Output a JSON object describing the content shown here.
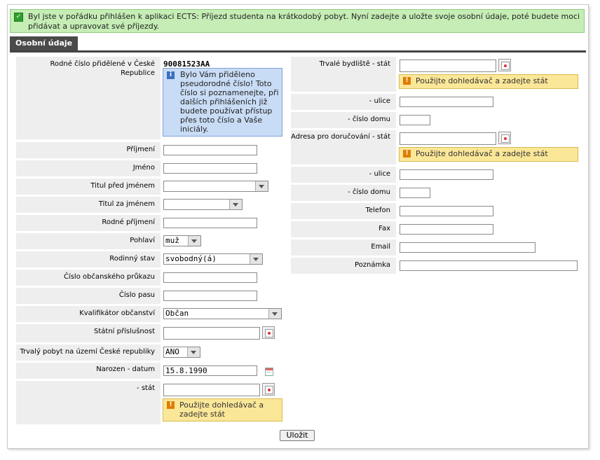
{
  "notice": {
    "text": "Byl jste v pořádku přihlášen k aplikaci ECTS: Příjezd studenta na krátkodobý pobyt. Nyní zadejte a uložte svoje osobní údaje, poté budete moci přidávat a upravovat své příjezdy."
  },
  "tab": {
    "label": "Osobní údaje"
  },
  "left": {
    "rodne_cislo_label": "Rodné číslo přidělené v České Republice",
    "rodne_cislo_value": "90081523AA",
    "info_text": "Bylo Vám přiděleno pseudorodné číslo! Toto číslo si poznamenejte, při dalších přihlášeních již budete používat přístup přes toto číslo a Vaše iniciály.",
    "prijmeni": "Příjmení",
    "jmeno": "Jméno",
    "titul_pred": "Titul před jménem",
    "titul_za": "Titul za jménem",
    "rodne_prijmeni": "Rodné příjmení",
    "pohlavi": "Pohlaví",
    "pohlavi_value": "muž",
    "rodinny_stav": "Rodinný stav",
    "rodinny_stav_value": "svobodný(á)",
    "cislo_op": "Číslo občanského průkazu",
    "cislo_pasu": "Číslo pasu",
    "kvalifikator": "Kvalifikátor občanství",
    "kvalifikator_value": "Občan",
    "statni_prislusnost": "Státní příslušnost",
    "trvaly_pobyt": "Trvalý pobyt na území České republiky",
    "trvaly_pobyt_value": "ANO",
    "narozeni_datum": "Narozen - datum",
    "narozeni_datum_value": "15.8.1990",
    "narozeni_stat": "- stát",
    "warn": "Použijte dohledávač a zadejte stát"
  },
  "right": {
    "trvale_stat": "Trvalé bydliště - stát",
    "warn": "Použijte dohledávač a zadejte stát",
    "ulice": "- ulice",
    "cislo_domu": "- číslo domu",
    "doruc_stat": "Adresa pro doručování - stát",
    "ulice2": "- ulice",
    "cislo_domu2": "- číslo domu",
    "telefon": "Telefon",
    "fax": "Fax",
    "email": "Email",
    "poznamka": "Poznámka"
  },
  "save_button": "Uložit",
  "colors": {
    "notice_bg": "#c5edb5",
    "info_bg": "#c9dcf5",
    "warn_bg": "#fbe798",
    "tab_bg": "#4a4a4a"
  }
}
